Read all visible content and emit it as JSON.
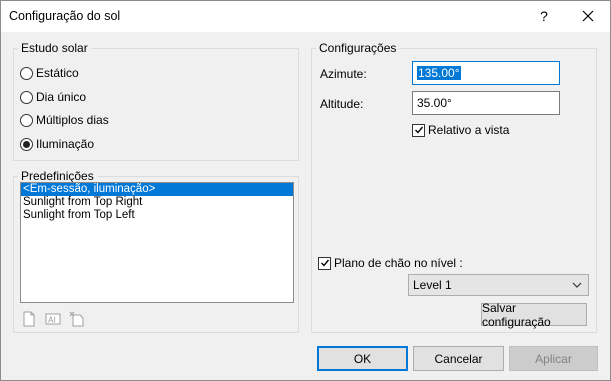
{
  "window": {
    "title": "Configuração do sol",
    "help_glyph": "?"
  },
  "solar_study": {
    "label": "Estudo solar",
    "options": [
      {
        "label": "Estático",
        "checked": false
      },
      {
        "label": "Dia único",
        "checked": false
      },
      {
        "label": "Múltiplos dias",
        "checked": false
      },
      {
        "label": "Iluminação",
        "checked": true
      }
    ]
  },
  "presets": {
    "label": "Predefinições",
    "items": [
      {
        "label": "<Em-sessão, iluminação>",
        "selected": true
      },
      {
        "label": "Sunlight from Top Right",
        "selected": false
      },
      {
        "label": "Sunlight from Top Left",
        "selected": false
      }
    ],
    "tools": [
      "duplicate-preset-icon",
      "rename-preset-icon",
      "delete-preset-icon"
    ]
  },
  "settings": {
    "label": "Configurações",
    "azimuth_label": "Azimute:",
    "azimuth_value": "135.00°",
    "altitude_label": "Altitude:",
    "altitude_value": "35.00°",
    "relative_to_view_label": "Relativo a vista",
    "relative_to_view_checked": true,
    "ground_plane_label": "Plano de chão no nível :",
    "ground_plane_checked": true,
    "level_value": "Level 1",
    "save_settings_label": "Salvar configuração"
  },
  "footer": {
    "ok_label": "OK",
    "cancel_label": "Cancelar",
    "apply_label": "Aplicar",
    "apply_enabled": false
  },
  "colors": {
    "accent": "#0078d7",
    "dialog_bg": "#f0f0f0"
  }
}
